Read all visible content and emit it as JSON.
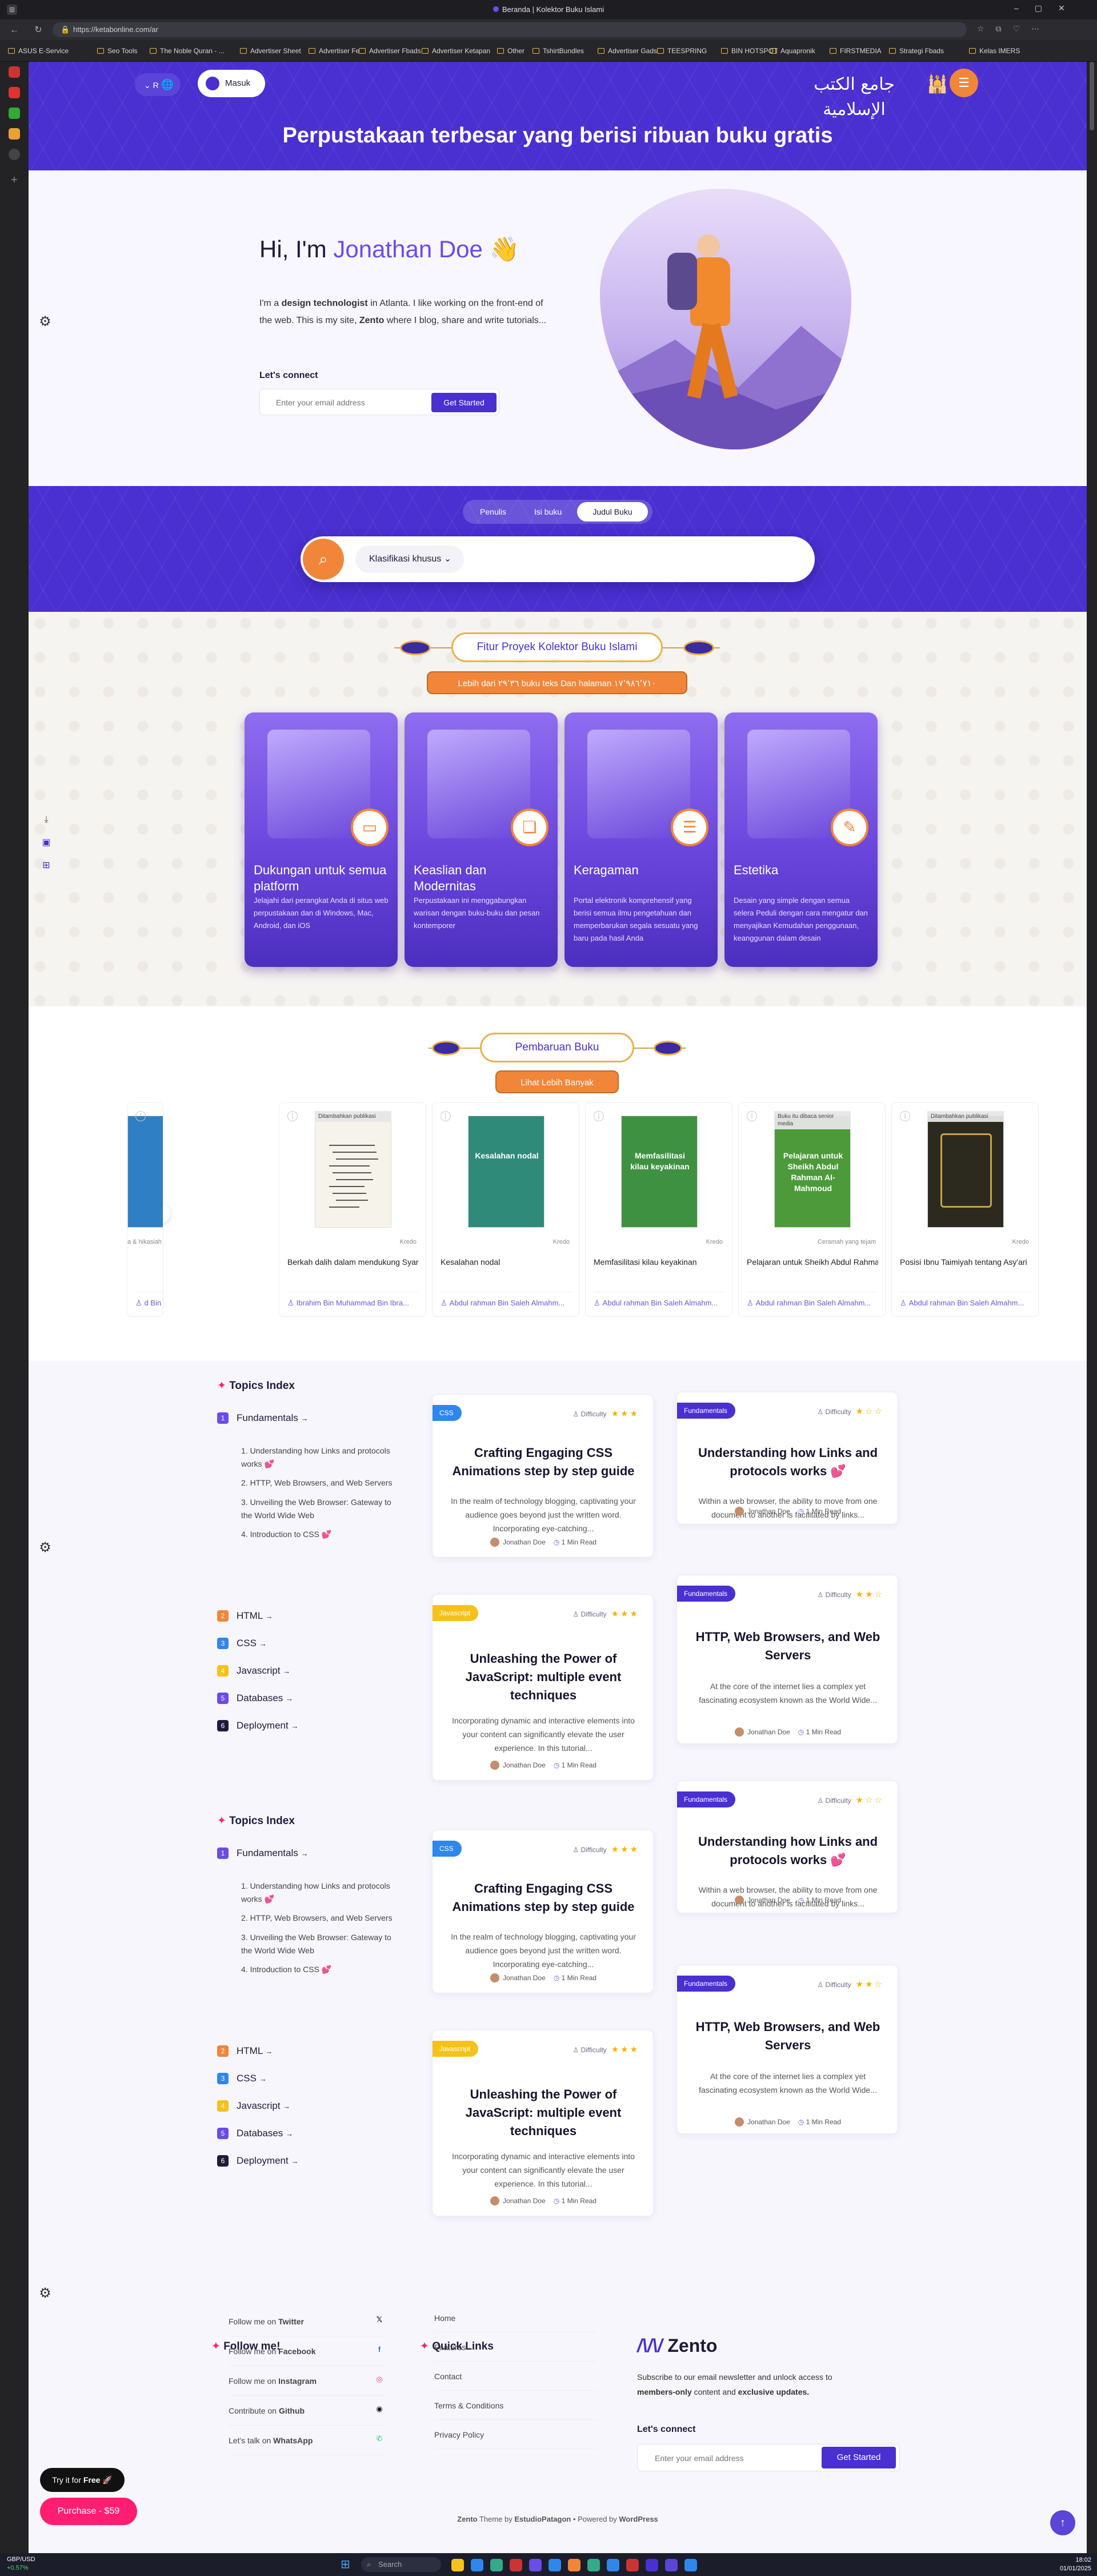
{
  "browser": {
    "tab_title": "Beranda | Kolektor Buku Islami",
    "url": "https://ketabonline.com/ar",
    "bookmarks": [
      "ASUS E-Service",
      "Seo Tools",
      "The Noble Quran - ...",
      "Advertiser Sheet",
      "Advertiser Fe",
      "Advertiser Fbads",
      "Advertiser Ketapan",
      "Other",
      "TshirtBundles",
      "Advertiser Gads",
      "TEESPRING",
      "BIN HOTSPOT",
      "Aquapronik",
      "FIRSTMEDIA",
      "Strategi Fbads",
      "Kelas IMERS"
    ]
  },
  "header": {
    "lang_label": "R",
    "login_label": "Masuk",
    "banner_title": "Perpustakaan terbesar yang berisi ribuan buku gratis",
    "logo_text": "جامع الكتب الإسلامية"
  },
  "hero": {
    "greeting": "Hi, I'm",
    "name": "Jonathan Doe",
    "wave": "👋",
    "bio_1": "I'm a ",
    "bio_2": "design technologist",
    "bio_3": " in Atlanta. I like working on the front-end of the web. This is my site, ",
    "bio_4": "Zento",
    "bio_5": " where I blog, share and write tutorials...",
    "connect_label": "Let's connect",
    "email_placeholder": "Enter your email address",
    "cta_label": "Get Started"
  },
  "search": {
    "tabs": [
      "Penulis",
      "Isi buku",
      "Judul Buku"
    ],
    "active_tab": "Judul Buku",
    "filter_label": "Klasifikasi khusus"
  },
  "features": {
    "title": "Fitur Proyek Kolektor Buku Islami",
    "subtitle": "Lebih dari ٢٩٬٣٦ buku teks Dan halaman ١٧٬٩٨٦٬٧١٠",
    "cards": [
      {
        "title": "Dukungan untuk semua platform",
        "desc": "Jelajahi dari perangkat Anda di situs web perpustakaan dan di Windows, Mac, Android, dan iOS",
        "icon": "devices-icon"
      },
      {
        "title": "Keaslian dan Modernitas",
        "desc": "Perpustakaan ini menggabungkan warisan dengan buku-buku dan pesan kontemporer",
        "icon": "book-icon"
      },
      {
        "title": "Keragaman",
        "desc": "Portal elektronik komprehensif yang berisi semua ilmu pengetahuan dan memperbarukan segala sesuatu yang baru pada hasil Anda",
        "icon": "list-icon"
      },
      {
        "title": "Estetika",
        "desc": "Desain yang simple dengan semua selera Peduli dengan cara mengatur dan menyajikan Kemudahan penggunaan, keanggunan dalam desain",
        "icon": "pen-icon"
      }
    ]
  },
  "updates": {
    "title": "Pembaruan Buku",
    "view_more": "Lihat Lebih Banyak",
    "books": [
      {
        "title": "",
        "author": "d Bin Bra...",
        "tag": "a & hikasiah"
      },
      {
        "title": "Berkah dalih dalam mendukung Syariah",
        "author": "Ibrahim Bin Muhammad Bin Ibra...",
        "tag": "Kredo",
        "badge": "Ditambahkan publikasi"
      },
      {
        "title": "Kesalahan nodal",
        "author": "Abdul rahman Bin Saleh Almahm...",
        "tag": "Kredo",
        "cover_text": "Kesalahan nodal"
      },
      {
        "title": "Memfasilitasi kilau keyakinan",
        "author": "Abdul rahman Bin Saleh Almahm...",
        "tag": "Kredo",
        "cover_text": "Memfasilitasi kilau keyakinan"
      },
      {
        "title": "Pelajaran untuk Sheikh Abdul Rahman Al-Mahmoud",
        "author": "Abdul rahman Bin Saleh Almahm...",
        "tag": "Ceramah yang tejam",
        "badge": "Buku itu dibaca senior media",
        "cover_text": "Pelajaran untuk Sheikh Abdul Rahman Al-Mahmoud"
      },
      {
        "title": "Posisi Ibnu Taimiyah tentang Asy'ari",
        "author": "Abdul rahman Bin Saleh Almahm...",
        "tag": "Kredo",
        "badge": "Ditambahkan publikasi"
      }
    ]
  },
  "topics": {
    "title": "Topics Index",
    "items": [
      {
        "num": "1",
        "label": "Fundamentals",
        "color": "#6b4ce6"
      },
      {
        "num": "2",
        "label": "HTML",
        "color": "#f1863a"
      },
      {
        "num": "3",
        "label": "CSS",
        "color": "#2f86eb"
      },
      {
        "num": "4",
        "label": "Javascript",
        "color": "#f5c21b"
      },
      {
        "num": "5",
        "label": "Databases",
        "color": "#6b4ce6"
      },
      {
        "num": "6",
        "label": "Deployment",
        "color": "#1f1b3a"
      }
    ],
    "subitems": [
      "1. Understanding how Links and protocols works 💕",
      "2. HTTP, Web Browsers, and Web Servers",
      "3. Unveiling the Web Browser: Gateway to the World Wide Web",
      "4. Introduction to CSS 💕"
    ]
  },
  "posts": {
    "difficulty_label": "Difficulty",
    "author": "Jonathan Doe",
    "read_time": "1 Min Read",
    "css": {
      "tag": "CSS",
      "title": "Crafting Engaging CSS Animations step by step guide",
      "excerpt": "In the realm of technology blogging, captivating your audience goes beyond just the written word. Incorporating eye-catching..."
    },
    "js": {
      "tag": "Javascript",
      "title": "Unleashing the Power of JavaScript: multiple event techniques",
      "excerpt": "Incorporating dynamic and interactive elements into your content can significantly elevate the user experience. In this tutorial..."
    },
    "links": {
      "tag": "Fundamentals",
      "title": "Understanding how Links and protocols works 💕",
      "excerpt": "Within a web browser, the ability to move from one document to another is facilitated by links..."
    },
    "http": {
      "tag": "Fundamentals",
      "title": "HTTP, Web Browsers, and Web Servers",
      "excerpt": "At the core of the internet lies a complex yet fascinating ecosystem known as the World Wide..."
    }
  },
  "footer": {
    "follow_title": "Follow me!",
    "follow": [
      {
        "pre": "Follow me on ",
        "bold": "Twitter",
        "icon": "x-icon",
        "color": "#111111"
      },
      {
        "pre": "Follow me on ",
        "bold": "Facebook",
        "icon": "facebook-icon",
        "color": "#1877f2"
      },
      {
        "pre": "Follow me on ",
        "bold": "Instagram",
        "icon": "instagram-icon",
        "color": "#e4405f"
      },
      {
        "pre": "Contribute on ",
        "bold": "Github",
        "icon": "github-icon",
        "color": "#111111"
      },
      {
        "pre": "Let's talk on ",
        "bold": "WhatsApp",
        "icon": "whatsapp-icon",
        "color": "#25d366"
      }
    ],
    "quick_title": "Quick Links",
    "quick_links": [
      "Home",
      "Features",
      "Contact",
      "Terms & Conditions",
      "Privacy Policy"
    ],
    "brand": "Zento",
    "newsletter_1": "Subscribe to our email newsletter and unlock access to ",
    "newsletter_2": "members-only",
    "newsletter_3": " content and ",
    "newsletter_4": "exclusive updates.",
    "connect_label": "Let's connect",
    "email_placeholder": "Enter your email address",
    "cta_label": "Get Started",
    "credit_1": "Zento",
    "credit_2": " Theme by ",
    "credit_3": "EstudioPatagon",
    "credit_4": " • Powered by ",
    "credit_5": "WordPress",
    "try_label": "Try it for ",
    "try_bold": "Free",
    "purchase_label": "Purchase - $59"
  },
  "taskbar": {
    "ticker": "GBP/USD",
    "ticker_change": "+0.57%",
    "search_placeholder": "Search",
    "time": "18:02",
    "date": "01/01/2025"
  },
  "colors": {
    "primary": "#4a2fd1",
    "accent": "#f1863a",
    "pink": "#ff1e72"
  }
}
